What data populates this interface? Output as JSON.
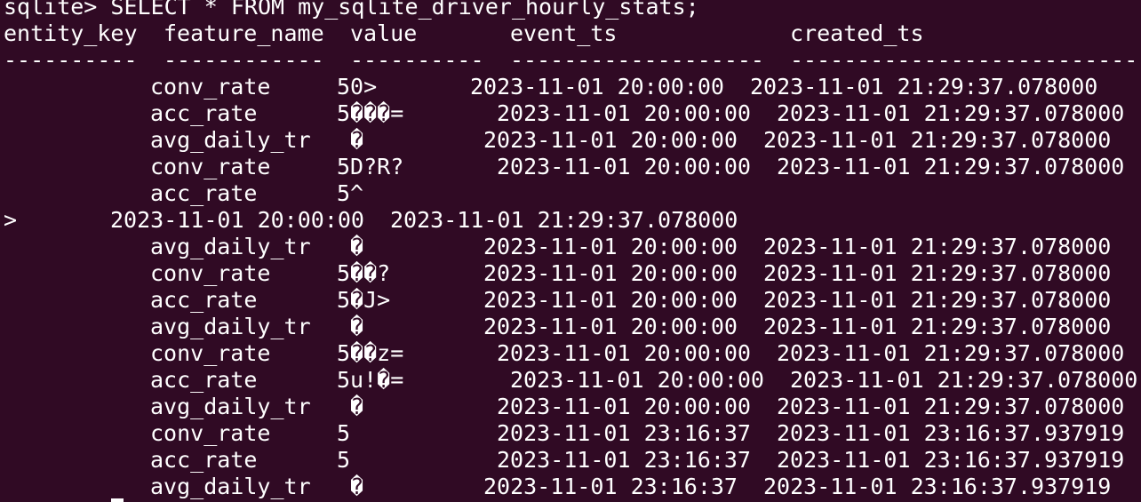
{
  "terminal": {
    "prompt_line": "sqlite> SELECT * FROM my_sqlite_driver_hourly_stats;",
    "headers": [
      "entity_key",
      "feature_name",
      "value",
      "event_ts",
      "created_ts"
    ],
    "separators": [
      "----------",
      "------------",
      "----------",
      "-------------------",
      "--------------------------"
    ],
    "rows": [
      {
        "feature": "conv_rate",
        "value": "50>",
        "event_ts": "2023-11-01 20:00:00",
        "created_ts": "2023-11-01 21:29:37.078000"
      },
      {
        "feature": "acc_rate",
        "value": "5���=",
        "event_ts": "2023-11-01 20:00:00",
        "created_ts": "2023-11-01 21:29:37.078000"
      },
      {
        "feature": "avg_daily_tr",
        "value": "�",
        "event_ts": "2023-11-01 20:00:00",
        "created_ts": "2023-11-01 21:29:37.078000"
      },
      {
        "feature": "conv_rate",
        "value": "5D?R?",
        "event_ts": "2023-11-01 20:00:00",
        "created_ts": "2023-11-01 21:29:37.078000"
      },
      {
        "feature": "acc_rate",
        "value": "5^",
        "event_ts": "",
        "created_ts": ""
      },
      {
        "wrap_prefix": ">",
        "event_ts": "2023-11-01 20:00:00",
        "created_ts": "2023-11-01 21:29:37.078000"
      },
      {
        "feature": "avg_daily_tr",
        "value": "�",
        "event_ts": "2023-11-01 20:00:00",
        "created_ts": "2023-11-01 21:29:37.078000"
      },
      {
        "feature": "conv_rate",
        "value": "5��?",
        "event_ts": "2023-11-01 20:00:00",
        "created_ts": "2023-11-01 21:29:37.078000"
      },
      {
        "feature": "acc_rate",
        "value": "5�J>",
        "event_ts": "2023-11-01 20:00:00",
        "created_ts": "2023-11-01 21:29:37.078000"
      },
      {
        "feature": "avg_daily_tr",
        "value": "�",
        "event_ts": "2023-11-01 20:00:00",
        "created_ts": "2023-11-01 21:29:37.078000"
      },
      {
        "feature": "conv_rate",
        "value": "5��z=",
        "event_ts": "2023-11-01 20:00:00",
        "created_ts": "2023-11-01 21:29:37.078000"
      },
      {
        "feature": "acc_rate",
        "value": "5u!�=",
        "event_ts": "2023-11-01 20:00:00",
        "created_ts": "2023-11-01 21:29:37.078000"
      },
      {
        "feature": "avg_daily_tr",
        "value": "�",
        "event_ts": "2023-11-01 20:00:00",
        "created_ts": "2023-11-01 21:29:37.078000"
      },
      {
        "feature": "conv_rate",
        "value": "5",
        "event_ts": "2023-11-01 23:16:37",
        "created_ts": "2023-11-01 23:16:37.937919"
      },
      {
        "feature": "acc_rate",
        "value": "5",
        "event_ts": "2023-11-01 23:16:37",
        "created_ts": "2023-11-01 23:16:37.937919"
      },
      {
        "feature": "avg_daily_tr",
        "value": "�",
        "event_ts": "2023-11-01 23:16:37",
        "created_ts": "2023-11-01 23:16:37.937919"
      }
    ]
  },
  "colors": {
    "background": "#300a24",
    "foreground": "#ffffff"
  }
}
